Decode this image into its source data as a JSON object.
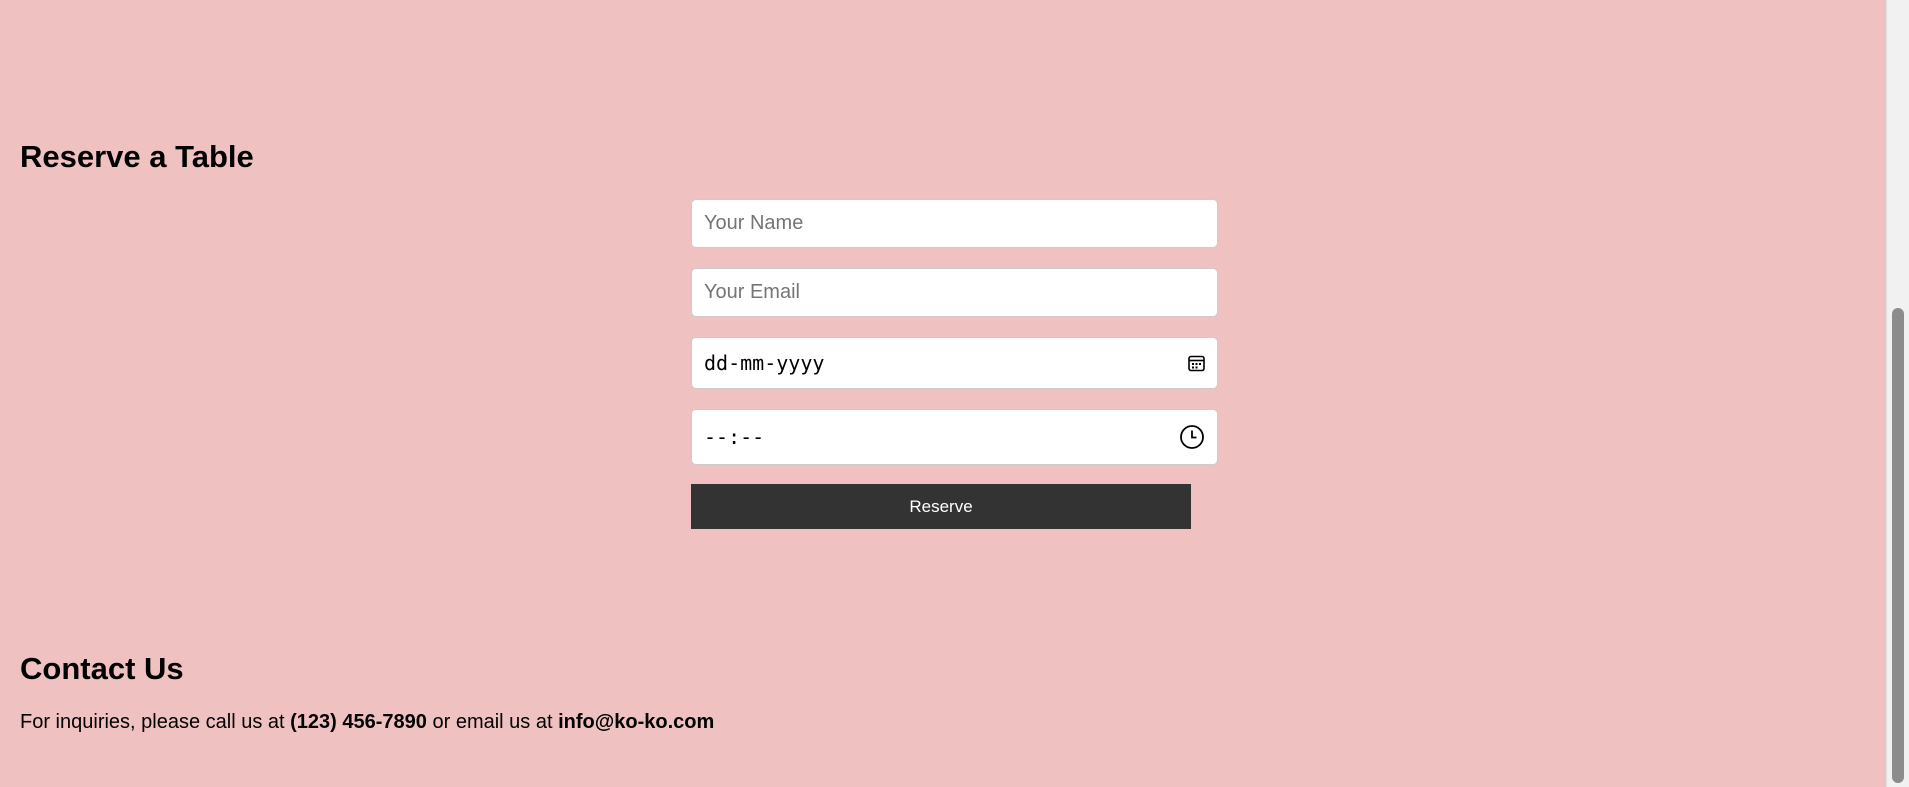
{
  "reservation": {
    "heading": "Reserve a Table",
    "name_placeholder": "Your Name",
    "email_placeholder": "Your Email",
    "date_placeholder": "dd-mm-yyyy",
    "time_placeholder": "--:--",
    "submit_label": "Reserve"
  },
  "icons": {
    "date_picker": "calendar-icon",
    "time_picker": "clock-icon"
  },
  "contact": {
    "heading": "Contact Us",
    "text_before_phone": "For inquiries, please call us at ",
    "phone": "(123) 456-7890",
    "text_between": " or email us at ",
    "email": "info@ko-ko.com"
  },
  "colors": {
    "background": "#f0c1c1",
    "button": "#333333",
    "button_text": "#ffffff"
  }
}
